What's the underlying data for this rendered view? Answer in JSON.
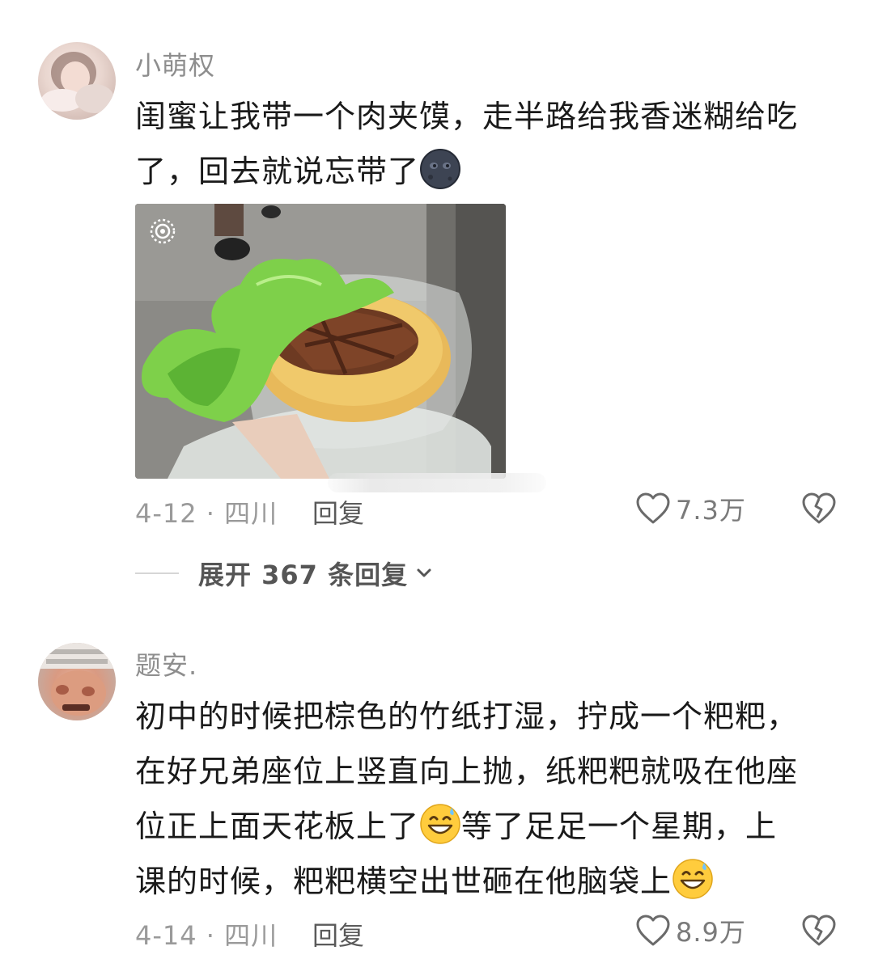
{
  "comments": [
    {
      "username": "小萌权",
      "text_line1": "闺蜜让我带一个肉夹馍，走半路给我香迷糊给吃",
      "text_line2": "了，回去就说忘带了",
      "emoji": "new-moon-face",
      "date_location": "4-12 · 四川",
      "reply_label": "回复",
      "likes": "7.3万",
      "expand_replies": "展开 367 条回复"
    },
    {
      "username": "题安.",
      "text_line1": "初中的时候把棕色的竹纸打湿，拧成一个粑粑，",
      "text_line2": "在好兄弟座位上竖直向上抛，纸粑粑就吸在他座",
      "text_line3a": "位正上面天花板上了",
      "text_line3b": "等了足足一个星期，上",
      "text_line4": "课的时候，粑粑横空出世砸在他脑袋上",
      "emoji": "grinning-sweat-face",
      "date_location": "4-14 · 四川",
      "reply_label": "回复",
      "likes": "8.9万"
    }
  ],
  "icons": {
    "like": "heart-outline-icon",
    "dislike": "broken-heart-icon",
    "expand": "chevron-down-icon",
    "live_photo": "live-photo-icon"
  },
  "colors": {
    "username": "#8e8e8e",
    "text": "#1a1a1a",
    "meta": "#9a9a9a"
  }
}
